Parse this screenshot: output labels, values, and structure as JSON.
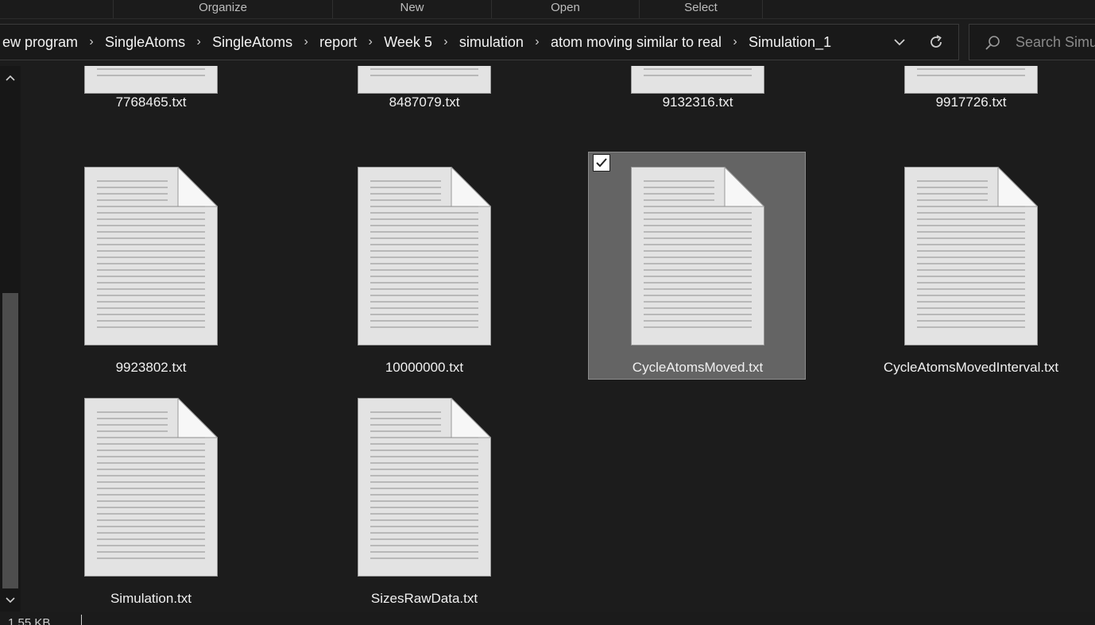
{
  "ribbon": {
    "groups": [
      "Organize",
      "New",
      "Open",
      "Select"
    ]
  },
  "address_bar": {
    "breadcrumbs": [
      "ew program",
      "SingleAtoms",
      "SingleAtoms",
      "report",
      "Week 5",
      "simulation",
      "atom moving similar to real",
      "Simulation_1"
    ],
    "dropdown_icon": "chevron-down-icon",
    "refresh_icon": "refresh-icon"
  },
  "search": {
    "placeholder": "Search Simu"
  },
  "files": [
    {
      "name": "7768465.txt",
      "selected": false,
      "icon": "text-file-icon"
    },
    {
      "name": "8487079.txt",
      "selected": false,
      "icon": "text-file-icon"
    },
    {
      "name": "9132316.txt",
      "selected": false,
      "icon": "text-file-icon"
    },
    {
      "name": "9917726.txt",
      "selected": false,
      "icon": "text-file-icon"
    },
    {
      "name": "9923802.txt",
      "selected": false,
      "icon": "text-file-icon"
    },
    {
      "name": "10000000.txt",
      "selected": false,
      "icon": "text-file-icon"
    },
    {
      "name": "CycleAtomsMoved.txt",
      "selected": true,
      "icon": "text-file-icon"
    },
    {
      "name": "CycleAtomsMovedInterval.txt",
      "selected": false,
      "icon": "text-file-icon"
    },
    {
      "name": "Simulation.txt",
      "selected": false,
      "icon": "text-file-icon"
    },
    {
      "name": "SizesRawData.txt",
      "selected": false,
      "icon": "text-file-icon"
    }
  ],
  "status_bar": {
    "text": "1.55 KB"
  },
  "colors": {
    "background": "#1c1c1c",
    "selection": "#646464",
    "text": "#f0f0f0"
  }
}
